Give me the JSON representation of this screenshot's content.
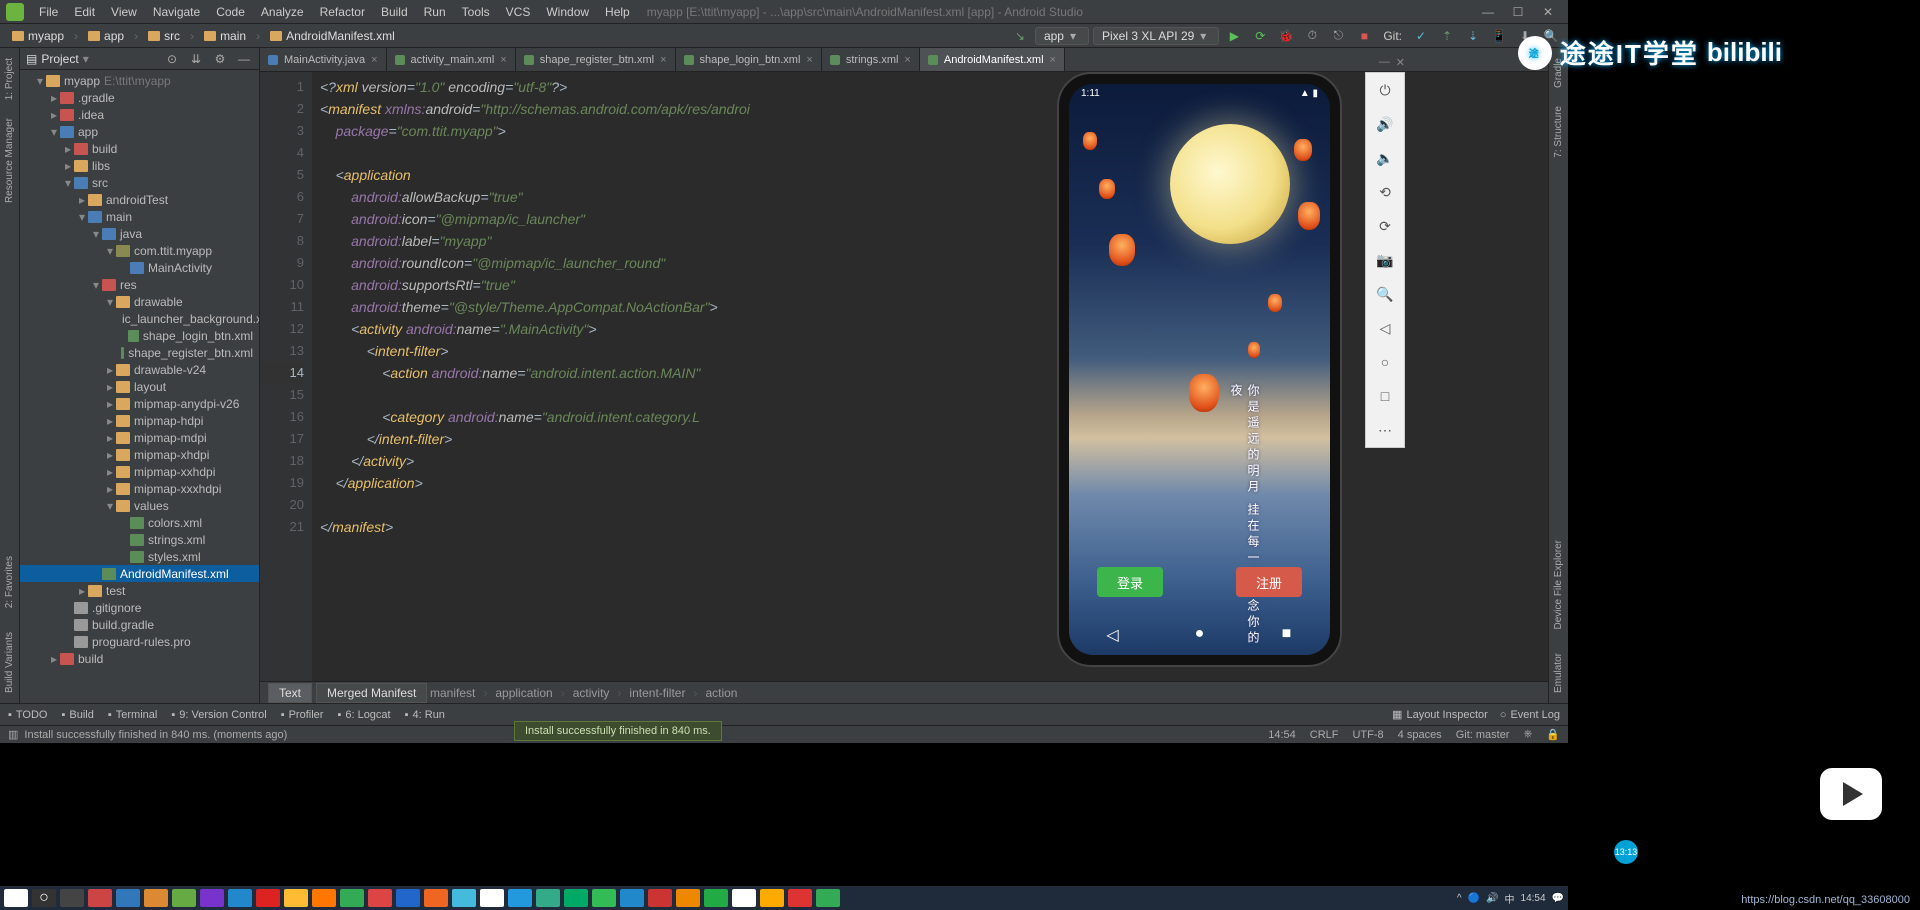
{
  "menu": {
    "items": [
      "File",
      "Edit",
      "View",
      "Navigate",
      "Code",
      "Analyze",
      "Refactor",
      "Build",
      "Run",
      "Tools",
      "VCS",
      "Window",
      "Help"
    ],
    "title": "myapp [E:\\ttit\\myapp] - ...\\app\\src\\main\\AndroidManifest.xml [app] - Android Studio"
  },
  "crumbs": {
    "parts": [
      "myapp",
      "app",
      "src",
      "main",
      "AndroidManifest.xml"
    ],
    "run_config": "app",
    "device": "Pixel 3 XL API 29",
    "git": "Git:"
  },
  "project": {
    "title": "Project",
    "tree": [
      {
        "d": 1,
        "a": "▾",
        "ic": "folder",
        "t": "myapp",
        "extra": " E:\\ttit\\myapp"
      },
      {
        "d": 2,
        "a": "▸",
        "ic": "folder-red",
        "t": ".gradle"
      },
      {
        "d": 2,
        "a": "▸",
        "ic": "folder-red",
        "t": ".idea"
      },
      {
        "d": 2,
        "a": "▾",
        "ic": "folder-blue",
        "t": "app"
      },
      {
        "d": 3,
        "a": "▸",
        "ic": "folder-red",
        "t": "build"
      },
      {
        "d": 3,
        "a": "▸",
        "ic": "folder",
        "t": "libs"
      },
      {
        "d": 3,
        "a": "▾",
        "ic": "folder-blue",
        "t": "src"
      },
      {
        "d": 4,
        "a": "▸",
        "ic": "folder",
        "t": "androidTest"
      },
      {
        "d": 4,
        "a": "▾",
        "ic": "folder-blue",
        "t": "main"
      },
      {
        "d": 5,
        "a": "▾",
        "ic": "folder-blue",
        "t": "java"
      },
      {
        "d": 6,
        "a": "▾",
        "ic": "pkg",
        "t": "com.ttit.myapp"
      },
      {
        "d": 7,
        "a": " ",
        "ic": "file-j",
        "t": "MainActivity"
      },
      {
        "d": 5,
        "a": "▾",
        "ic": "folder-red",
        "t": "res"
      },
      {
        "d": 6,
        "a": "▾",
        "ic": "folder",
        "t": "drawable"
      },
      {
        "d": 7,
        "a": " ",
        "ic": "file-x",
        "t": "ic_launcher_background.xml"
      },
      {
        "d": 7,
        "a": " ",
        "ic": "file-x",
        "t": "shape_login_btn.xml"
      },
      {
        "d": 7,
        "a": " ",
        "ic": "file-x",
        "t": "shape_register_btn.xml"
      },
      {
        "d": 6,
        "a": "▸",
        "ic": "folder",
        "t": "drawable-v24"
      },
      {
        "d": 6,
        "a": "▸",
        "ic": "folder",
        "t": "layout"
      },
      {
        "d": 6,
        "a": "▸",
        "ic": "folder",
        "t": "mipmap-anydpi-v26"
      },
      {
        "d": 6,
        "a": "▸",
        "ic": "folder",
        "t": "mipmap-hdpi"
      },
      {
        "d": 6,
        "a": "▸",
        "ic": "folder",
        "t": "mipmap-mdpi"
      },
      {
        "d": 6,
        "a": "▸",
        "ic": "folder",
        "t": "mipmap-xhdpi"
      },
      {
        "d": 6,
        "a": "▸",
        "ic": "folder",
        "t": "mipmap-xxhdpi"
      },
      {
        "d": 6,
        "a": "▸",
        "ic": "folder",
        "t": "mipmap-xxxhdpi"
      },
      {
        "d": 6,
        "a": "▾",
        "ic": "folder",
        "t": "values"
      },
      {
        "d": 7,
        "a": " ",
        "ic": "file-x",
        "t": "colors.xml"
      },
      {
        "d": 7,
        "a": " ",
        "ic": "file-x",
        "t": "strings.xml"
      },
      {
        "d": 7,
        "a": " ",
        "ic": "file-x",
        "t": "styles.xml"
      },
      {
        "d": 5,
        "a": " ",
        "ic": "file-x",
        "t": "AndroidManifest.xml",
        "sel": true
      },
      {
        "d": 4,
        "a": "▸",
        "ic": "folder",
        "t": "test"
      },
      {
        "d": 3,
        "a": " ",
        "ic": "file-g",
        "t": ".gitignore"
      },
      {
        "d": 3,
        "a": " ",
        "ic": "file-g",
        "t": "build.gradle"
      },
      {
        "d": 3,
        "a": " ",
        "ic": "file-g",
        "t": "proguard-rules.pro"
      },
      {
        "d": 2,
        "a": "▸",
        "ic": "folder-red",
        "t": "build"
      }
    ]
  },
  "tabs": [
    {
      "ic": "java",
      "t": "MainActivity.java"
    },
    {
      "ic": "xml",
      "t": "activity_main.xml"
    },
    {
      "ic": "xml",
      "t": "shape_register_btn.xml"
    },
    {
      "ic": "xml",
      "t": "shape_login_btn.xml"
    },
    {
      "ic": "xml",
      "t": "strings.xml"
    },
    {
      "ic": "xml",
      "t": "AndroidManifest.xml",
      "active": true
    }
  ],
  "editor": {
    "lines": [
      1,
      2,
      3,
      4,
      5,
      6,
      7,
      8,
      9,
      10,
      11,
      12,
      13,
      14,
      15,
      16,
      17,
      18,
      19,
      20,
      21
    ],
    "current": 14,
    "crumbs": [
      "manifest",
      "application",
      "activity",
      "intent-filter",
      "action"
    ],
    "modes": {
      "text": "Text",
      "merged": "Merged Manifest"
    }
  },
  "toast": "Install successfully finished in 840 ms.",
  "bottombar": {
    "items": [
      "TODO",
      "Build",
      "Terminal",
      "9: Version Control",
      "Profiler",
      "6: Logcat",
      "4: Run"
    ],
    "right": [
      "Layout Inspector",
      "Event Log"
    ]
  },
  "status": {
    "msg": "Install successfully finished in 840 ms. (moments ago)",
    "pos": "14:54",
    "eol": "CRLF",
    "enc": "UTF-8",
    "spaces": "4 spaces",
    "git": "Git: master"
  },
  "emu": {
    "time": "1:11",
    "right_icons": "▲ ▮",
    "login": "登录",
    "reg": "注册",
    "poem": "你是遥远的明月 挂在每一个思念你的夜"
  },
  "brand": {
    "txt1": "途途IT学堂",
    "txt2": "bilibili"
  },
  "taskbar": {
    "time": "14:54"
  },
  "blog": "https://blog.csdn.net/qq_33608000",
  "scrub": "13:13"
}
